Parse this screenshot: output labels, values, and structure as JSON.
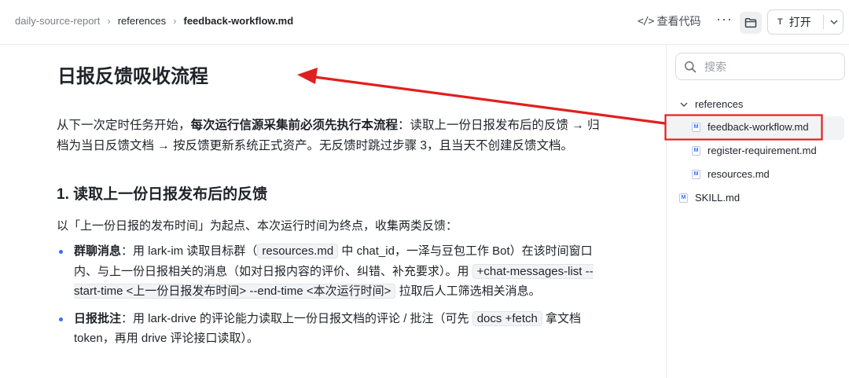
{
  "header": {
    "breadcrumbs": [
      "daily-source-report",
      "references",
      "feedback-workflow.md"
    ],
    "view_code_label": "查看代码",
    "more_label": "···",
    "open_label": "打开",
    "open_icon_text": "T"
  },
  "doc": {
    "title": "日报反馈吸收流程",
    "intro_pre": "从下一次定时任务开始，",
    "intro_bold": "每次运行信源采集前必须先执行本流程",
    "intro_post": "：读取上一份日报发布后的反馈 → 归档为当日反馈文档 → 按反馈更新系统正式资产。无反馈时跳过步骤 3，且当天不创建反馈文档。",
    "section1_title": "1. 读取上一份日报发布后的反馈",
    "section1_para": "以「上一份日报的发布时间」为起点、本次运行时间为终点，收集两类反馈：",
    "bullet1": {
      "bold": "群聊消息",
      "t1": "：用 lark-im 读取目标群（",
      "code1": "resources.md",
      "t2": " 中 chat_id，一泽与豆包工作 Bot）在该时间窗口内、与上一份日报相关的消息（如对日报内容的评价、纠错、补充要求）。用 ",
      "code2": "+chat-messages-list --start-time <上一份日报发布时间> --end-time <本次运行时间>",
      "t3": " 拉取后人工筛选相关消息。"
    },
    "bullet2": {
      "bold": "日报批注",
      "t1": "：用 lark-drive 的评论能力读取上一份日报文档的评论 / 批注（可先 ",
      "code1": "docs +fetch",
      "t2": " 拿文档 token，再用 drive 评论接口读取）。"
    }
  },
  "sidebar": {
    "search_placeholder": "搜索",
    "folder_label": "references",
    "files": [
      "feedback-workflow.md",
      "register-requirement.md",
      "resources.md"
    ],
    "root_file": "SKILL.md",
    "md_icon_text": "M"
  },
  "colors": {
    "accent": "#3370ff",
    "annotation": "#e0201e"
  }
}
